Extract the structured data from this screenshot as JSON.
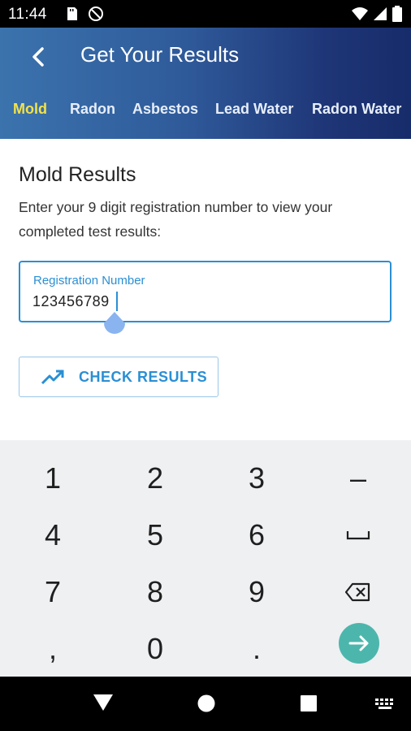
{
  "status_bar": {
    "time": "11:44",
    "left_icons": [
      "sd-card-icon",
      "dnd-icon"
    ],
    "right_icons": [
      "wifi-icon",
      "signal-icon",
      "battery-icon"
    ]
  },
  "header": {
    "title": "Get Your Results",
    "back_icon": "chevron-left-icon",
    "tabs": [
      {
        "label": "Mold",
        "active": true
      },
      {
        "label": "Radon",
        "active": false
      },
      {
        "label": "Asbestos",
        "active": false
      },
      {
        "label": "Lead Water",
        "active": false
      },
      {
        "label": "Radon Water",
        "active": false
      }
    ]
  },
  "content": {
    "title": "Mold Results",
    "instructions": "Enter your 9 digit registration number to view your completed test results:",
    "registration_field": {
      "label": "Registration Number",
      "value": "123456789"
    },
    "check_button": {
      "label": "CHECK RESULTS",
      "icon": "trending-up-icon"
    }
  },
  "keyboard": {
    "keys": [
      [
        "1",
        "2",
        "3",
        "–"
      ],
      [
        "4",
        "5",
        "6",
        "␣"
      ],
      [
        "7",
        "8",
        "9",
        "⌫"
      ],
      [
        ",",
        "0",
        ".",
        "→"
      ]
    ]
  },
  "nav_bar": {
    "icons": [
      "back-triangle-icon",
      "home-circle-icon",
      "recents-square-icon",
      "keyboard-icon"
    ]
  },
  "colors": {
    "header_gradient_start": "#3b73ad",
    "header_gradient_end": "#172c6a",
    "active_tab": "#f2e24a",
    "accent": "#2a8fd4",
    "enter_key": "#4db6ac",
    "keyboard_bg": "#eef0f2"
  }
}
